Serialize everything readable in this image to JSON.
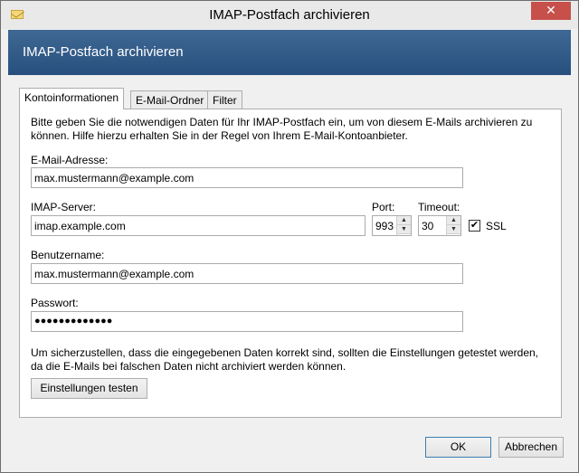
{
  "window": {
    "title": "IMAP-Postfach archivieren",
    "close_glyph": "✕",
    "app_icon": "envelope-icon"
  },
  "header": {
    "title": "IMAP-Postfach archivieren"
  },
  "tabs": [
    {
      "label": "Kontoinformationen",
      "active": true
    },
    {
      "label": "E-Mail-Ordner",
      "active": false
    },
    {
      "label": "Filter",
      "active": false
    }
  ],
  "panel": {
    "intro": "Bitte geben Sie die notwendigen Daten für Ihr IMAP-Postfach ein, um von diesem E-Mails archivieren zu können. Hilfe hierzu erhalten Sie in der Regel von Ihrem E-Mail-Kontoanbieter.",
    "email_label": "E-Mail-Adresse:",
    "email_value": "max.mustermann@example.com",
    "server_label": "IMAP-Server:",
    "server_value": "imap.example.com",
    "port_label": "Port:",
    "port_value": "993",
    "timeout_label": "Timeout:",
    "timeout_value": "30",
    "ssl_label": "SSL",
    "ssl_checked": true,
    "user_label": "Benutzername:",
    "user_value": "max.mustermann@example.com",
    "password_label": "Passwort:",
    "password_value": "●●●●●●●●●●●●●",
    "note": "Um sicherzustellen, dass die eingegebenen Daten korrekt sind, sollten die Einstellungen getestet werden, da die E-Mails bei falschen Daten nicht archiviert werden können.",
    "test_button": "Einstellungen testen"
  },
  "footer": {
    "ok": "OK",
    "cancel": "Abbrechen"
  },
  "spin_glyphs": {
    "up": "▲",
    "down": "▼"
  },
  "check_glyph": "✔"
}
